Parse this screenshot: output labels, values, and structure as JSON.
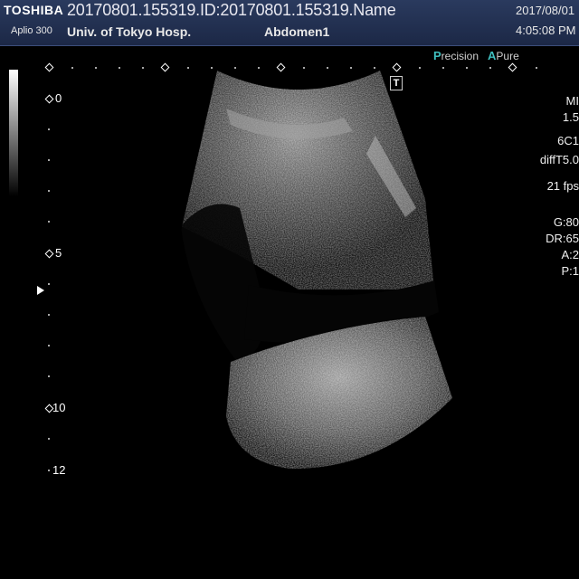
{
  "header": {
    "brand": "TOSHIBA",
    "model": "Aplio 300",
    "patient_id": "20170801.155319.ID:20170801.155319.Name",
    "hospital": "Univ. of Tokyo Hosp.",
    "exam": "Abdomen1",
    "date": "2017/08/01",
    "time": "4:05:08 PM"
  },
  "processing": {
    "precision": {
      "first": "P",
      "rest": "recision"
    },
    "pure": {
      "first": "A",
      "rest": "Pure"
    }
  },
  "depth_scale": {
    "labels": [
      "0",
      "5",
      "10",
      "12"
    ]
  },
  "t_marker": "T",
  "params": {
    "mi": "MI",
    "mi_value": "1.5",
    "probe": "6C1",
    "mode": "diffT5.0",
    "frame_rate": "21 fps",
    "gain": "G:80",
    "dynamic_range": "DR:65",
    "a": "A:2",
    "p": "P:1"
  },
  "colors": {
    "header_bg": "#22304f",
    "accent": "#3fbfbf"
  }
}
